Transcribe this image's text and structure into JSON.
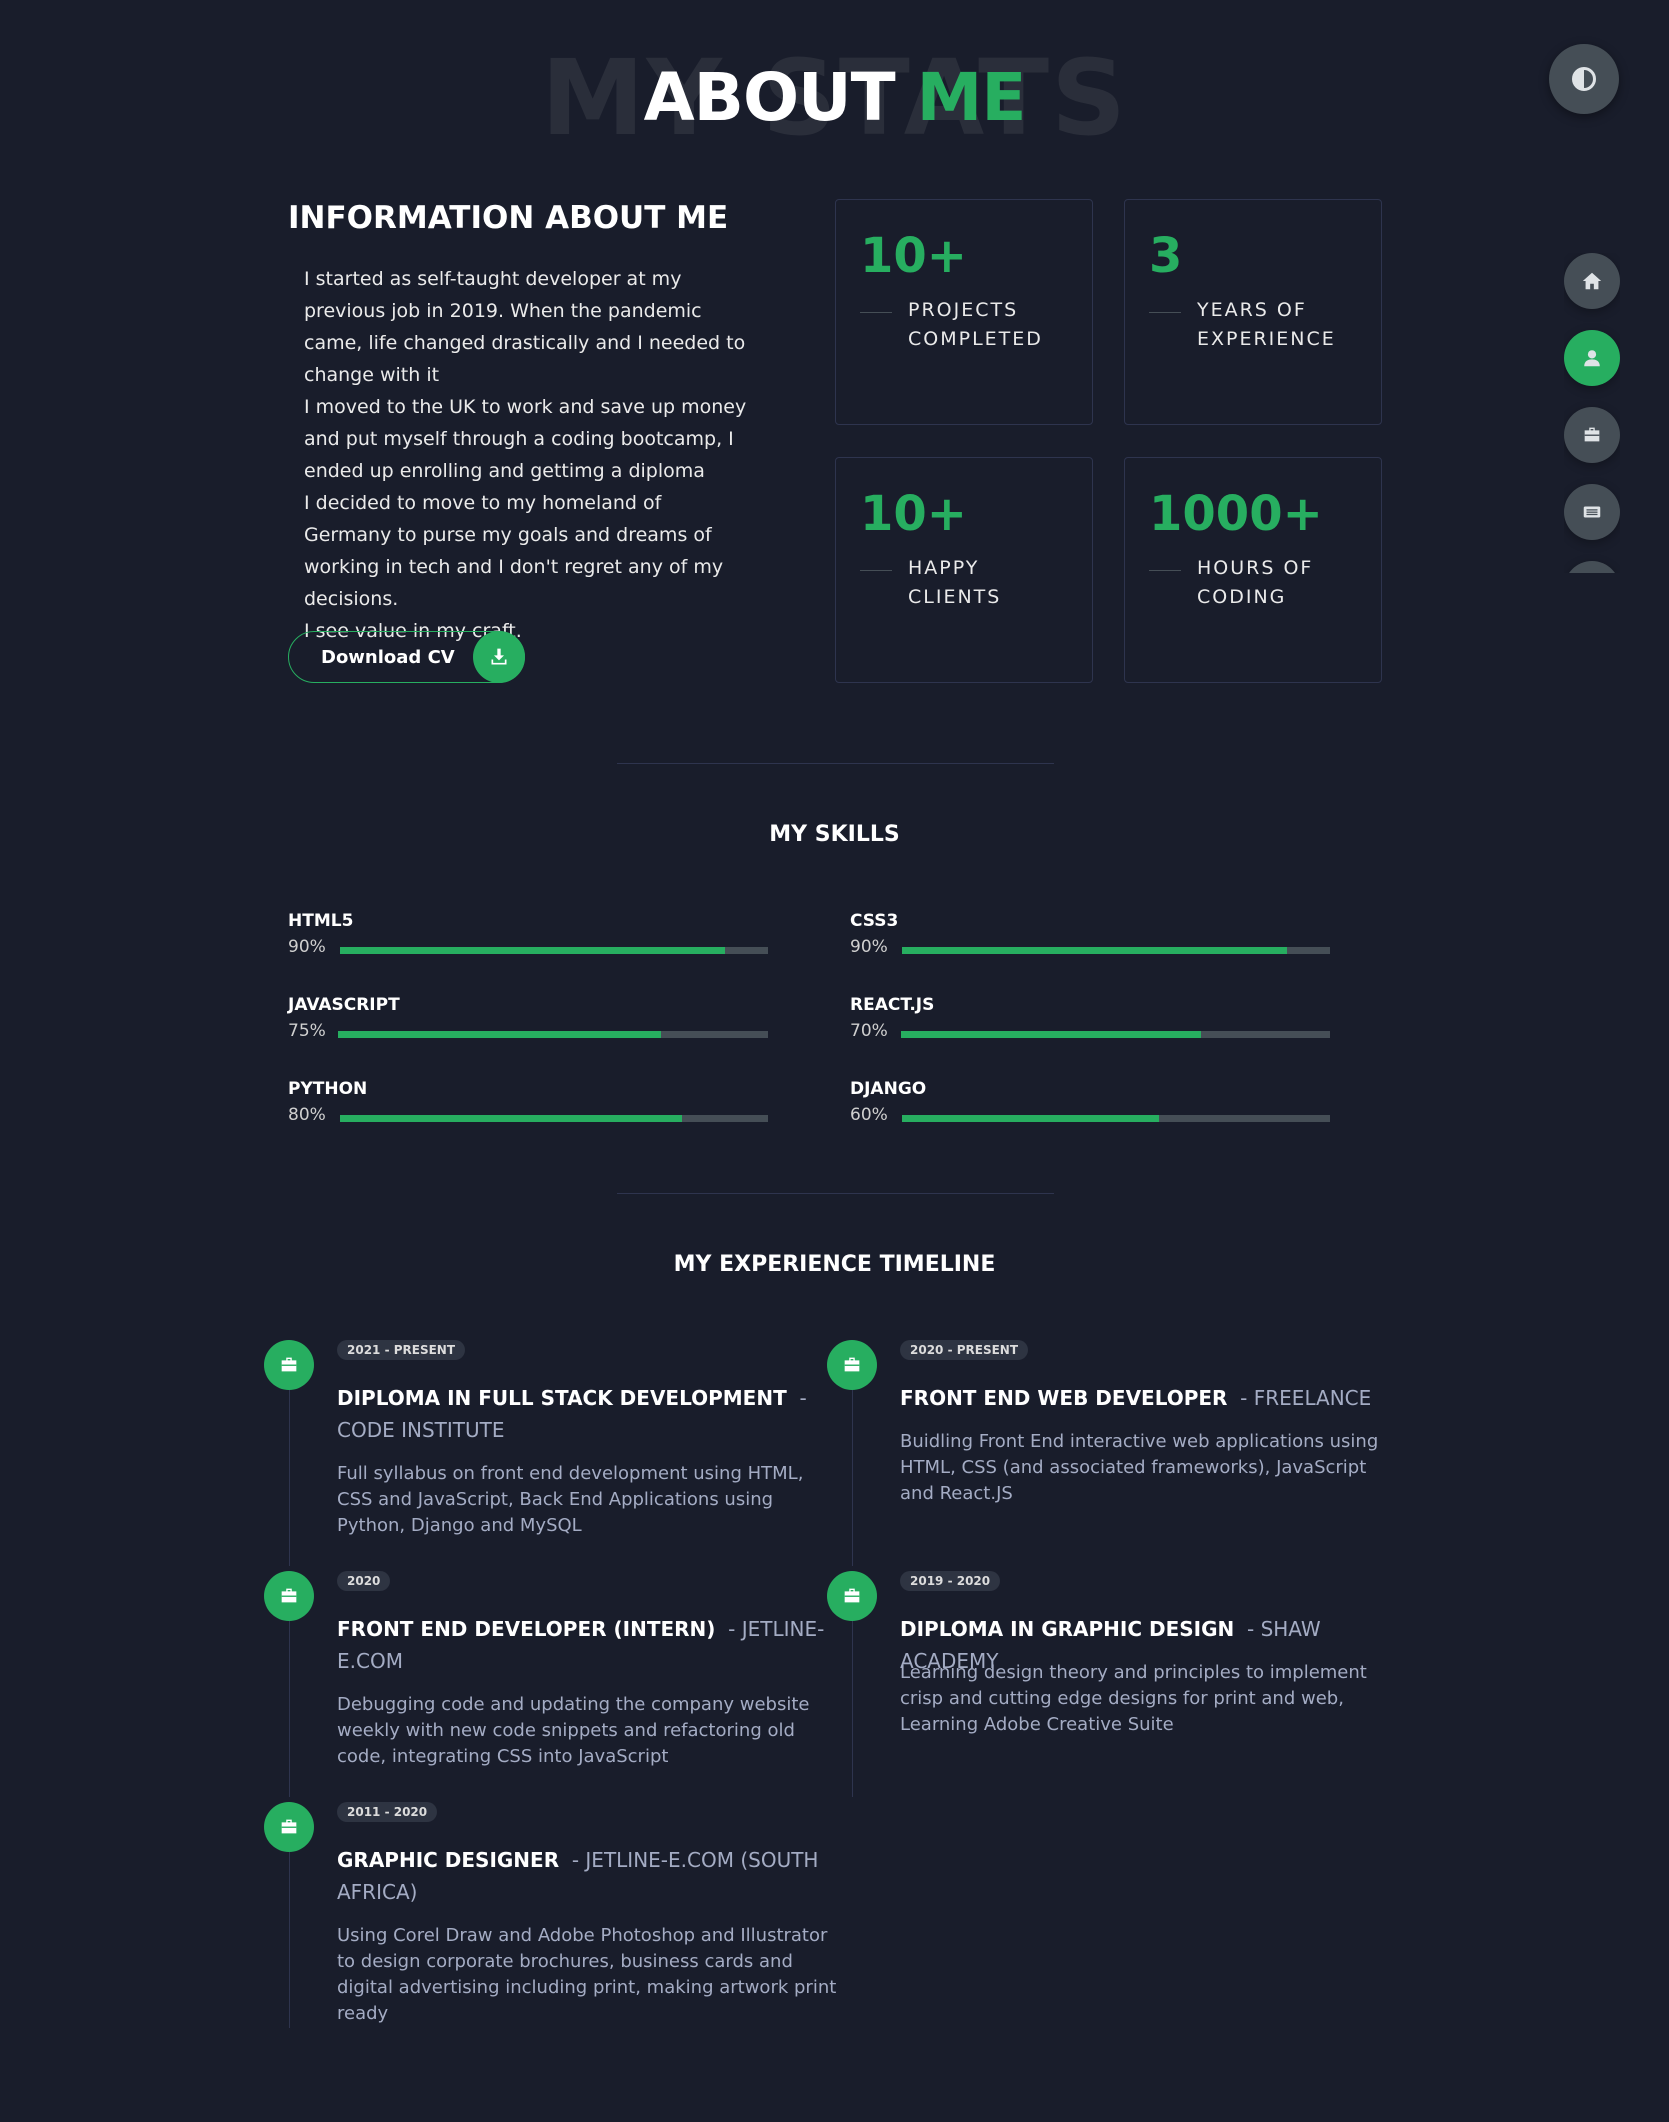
{
  "heading": {
    "background_text": "MY STATS",
    "title_main": "ABOUT",
    "title_accent": "ME"
  },
  "theme_toggle": {
    "icon": "contrast-icon"
  },
  "side_nav": {
    "items": [
      {
        "icon": "home-icon",
        "active": false
      },
      {
        "icon": "user-icon",
        "active": true
      },
      {
        "icon": "briefcase-icon",
        "active": false
      },
      {
        "icon": "blog-icon",
        "active": false
      }
    ]
  },
  "info": {
    "title": "INFORMATION ABOUT ME",
    "paragraphs": [
      "I started as self-taught developer at my previous job in 2019. When the pandemic came, life changed drastically and I needed to change with it",
      "I moved to the UK to work and save up money and put myself through a coding bootcamp, I ended up enrolling and gettimg a diploma",
      "I decided to move to my homeland of Germany to purse my goals and dreams of working in tech and I don't regret any of my decisions.",
      "I see value in my craft."
    ],
    "download_label": "Download CV",
    "download_icon": "download-icon"
  },
  "stats": [
    {
      "number": "10+",
      "label_line1": "PROJECTS",
      "label_line2": "COMPLETED"
    },
    {
      "number": "3",
      "label_line1": "YEARS OF",
      "label_line2": "EXPERIENCE"
    },
    {
      "number": "10+",
      "label_line1": "HAPPY",
      "label_line2": "CLIENTS"
    },
    {
      "number": "1000+",
      "label_line1": "HOURS OF",
      "label_line2": "CODING"
    }
  ],
  "skills": {
    "title": "MY SKILLS",
    "items": [
      {
        "name": "HTML5",
        "percent": "90%",
        "value": 90
      },
      {
        "name": "CSS3",
        "percent": "90%",
        "value": 90
      },
      {
        "name": "JAVASCRIPT",
        "percent": "75%",
        "value": 75
      },
      {
        "name": "REACT.JS",
        "percent": "70%",
        "value": 70
      },
      {
        "name": "PYTHON",
        "percent": "80%",
        "value": 80
      },
      {
        "name": "DJANGO",
        "percent": "60%",
        "value": 60
      }
    ]
  },
  "timeline": {
    "title": "MY EXPERIENCE TIMELINE",
    "items": [
      {
        "date": "2021 - PRESENT",
        "role": "DIPLOMA IN FULL STACK DEVELOPMENT",
        "org": "CODE INSTITUTE",
        "desc": "Full syllabus on front end development using HTML, CSS and JavaScript, Back End Applications using Python, Django and MySQL"
      },
      {
        "date": "2020 - PRESENT",
        "role": "FRONT END WEB DEVELOPER",
        "org": "FREELANCE",
        "desc": "Buidling Front End interactive web applications using HTML, CSS (and associated frameworks), JavaScript and React.JS"
      },
      {
        "date": "2020",
        "role": "FRONT END DEVELOPER (INTERN)",
        "org": "JETLINE-E.COM",
        "desc": "Debugging code and updating the company website weekly with new code snippets and refactoring old code, integrating CSS into JavaScript"
      },
      {
        "date": "2019 - 2020",
        "role": "DIPLOMA IN GRAPHIC DESIGN",
        "org": "SHAW ACADEMY",
        "desc": "Learning design theory and principles to implement crisp and cutting edge designs for print and web, Learning Adobe Creative Suite"
      },
      {
        "date": "2011 - 2020",
        "role": "GRAPHIC DESIGNER",
        "org": "JETLINE-E.COM (SOUTH AFRICA)",
        "desc": "Using Corel Draw and Adobe Photoshop and Illustrator to design corporate brochures, business cards and digital advertising including print, making artwork print ready"
      }
    ]
  },
  "colors": {
    "background": "#191d2b",
    "accent": "#27ae60",
    "card_border": "#2e344e",
    "muted": "#a4acc4",
    "button_grey": "#454e56"
  }
}
